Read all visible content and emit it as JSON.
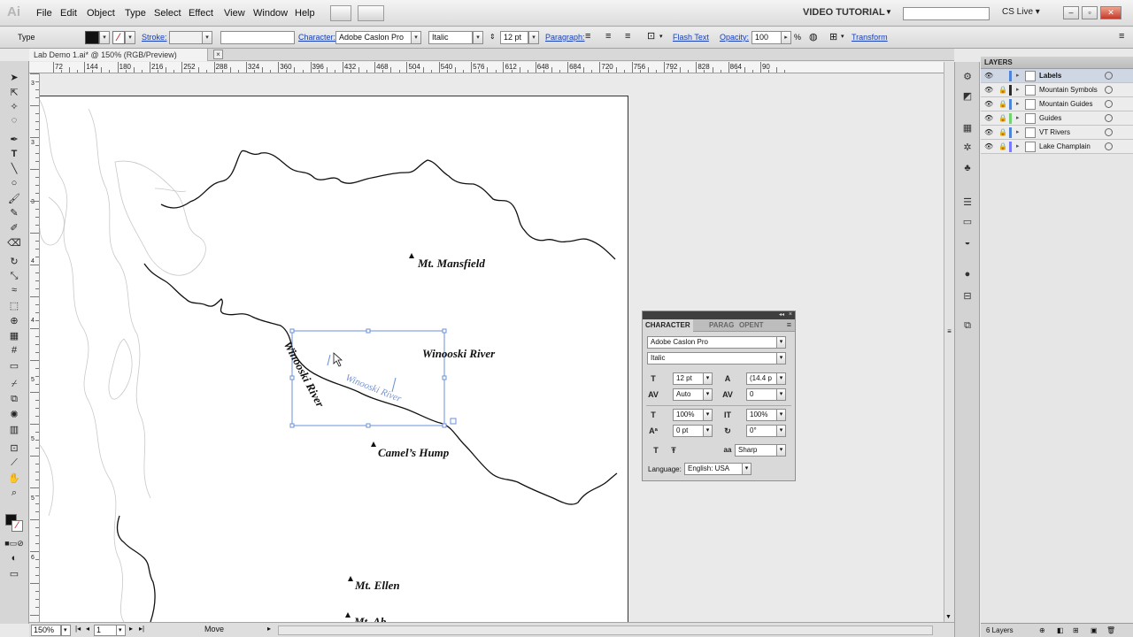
{
  "app": {
    "logo": "Ai",
    "menus": [
      "File",
      "Edit",
      "Object",
      "Type",
      "Select",
      "Effect",
      "View",
      "Window",
      "Help"
    ],
    "workspace": "VIDEO TUTORIAL",
    "cs_live": "CS Live"
  },
  "control_bar": {
    "tool_name": "Type",
    "stroke_label": "Stroke:",
    "character_label": "Character:",
    "font_family": "Adobe Caslon Pro",
    "font_style": "Italic",
    "font_size": "12 pt",
    "paragraph_label": "Paragraph:",
    "flash_text": "Flash Text",
    "opacity_label": "Opacity:",
    "opacity_value": "100",
    "percent": "%",
    "transform": "Transform"
  },
  "document": {
    "tab_title": "Lab Demo 1.ai* @ 150% (RGB/Preview)"
  },
  "ruler": {
    "top_labels": [
      "72",
      "144",
      "180",
      "216",
      "252",
      "288",
      "324",
      "360",
      "396",
      "432",
      "468",
      "504",
      "540",
      "576",
      "612",
      "648",
      "684",
      "720",
      "756",
      "792",
      "828",
      "864",
      "90"
    ],
    "left_labels": [
      "3",
      "3",
      "3",
      "4",
      "4",
      "5",
      "5",
      "5",
      "6"
    ]
  },
  "map_labels": {
    "mansfield": "Mt. Mansfield",
    "winooski": "Winooski River",
    "camels_hump": "Camel’s Hump",
    "ellen": "Mt. Ellen",
    "abe": "Mt. Ab",
    "path_text": "Winooski River",
    "path_text_preview": "Winooski River"
  },
  "status_bar": {
    "zoom": "150%",
    "artboard": "1",
    "status": "Move"
  },
  "layers_panel": {
    "title": "LAYERS",
    "layers": [
      {
        "name": "Labels",
        "color": "#4f82d9",
        "locked": false,
        "selected": true
      },
      {
        "name": "Mountain Symbols",
        "color": "#2b2b2b",
        "locked": true,
        "selected": false
      },
      {
        "name": "Mountain Guides",
        "color": "#4f82d9",
        "locked": true,
        "selected": false
      },
      {
        "name": "Guides",
        "color": "#74d174",
        "locked": true,
        "selected": false
      },
      {
        "name": "VT Rivers",
        "color": "#4f82d9",
        "locked": true,
        "selected": false
      },
      {
        "name": "Lake Champlain",
        "color": "#7a7aff",
        "locked": true,
        "selected": false
      }
    ],
    "footer": "6 Layers"
  },
  "character_panel": {
    "tabs": [
      "CHARACTER",
      "PARAG",
      "OPENT"
    ],
    "font_family": "Adobe Caslon Pro",
    "font_style": "Italic",
    "size": "12 pt",
    "leading": "(14.4 p",
    "kerning": "Auto",
    "tracking": "0",
    "vscale": "100%",
    "hscale": "100%",
    "baseline": "0 pt",
    "rotation": "0°",
    "antialias": "Sharp",
    "language_label": "Language:",
    "language": "English: USA"
  }
}
